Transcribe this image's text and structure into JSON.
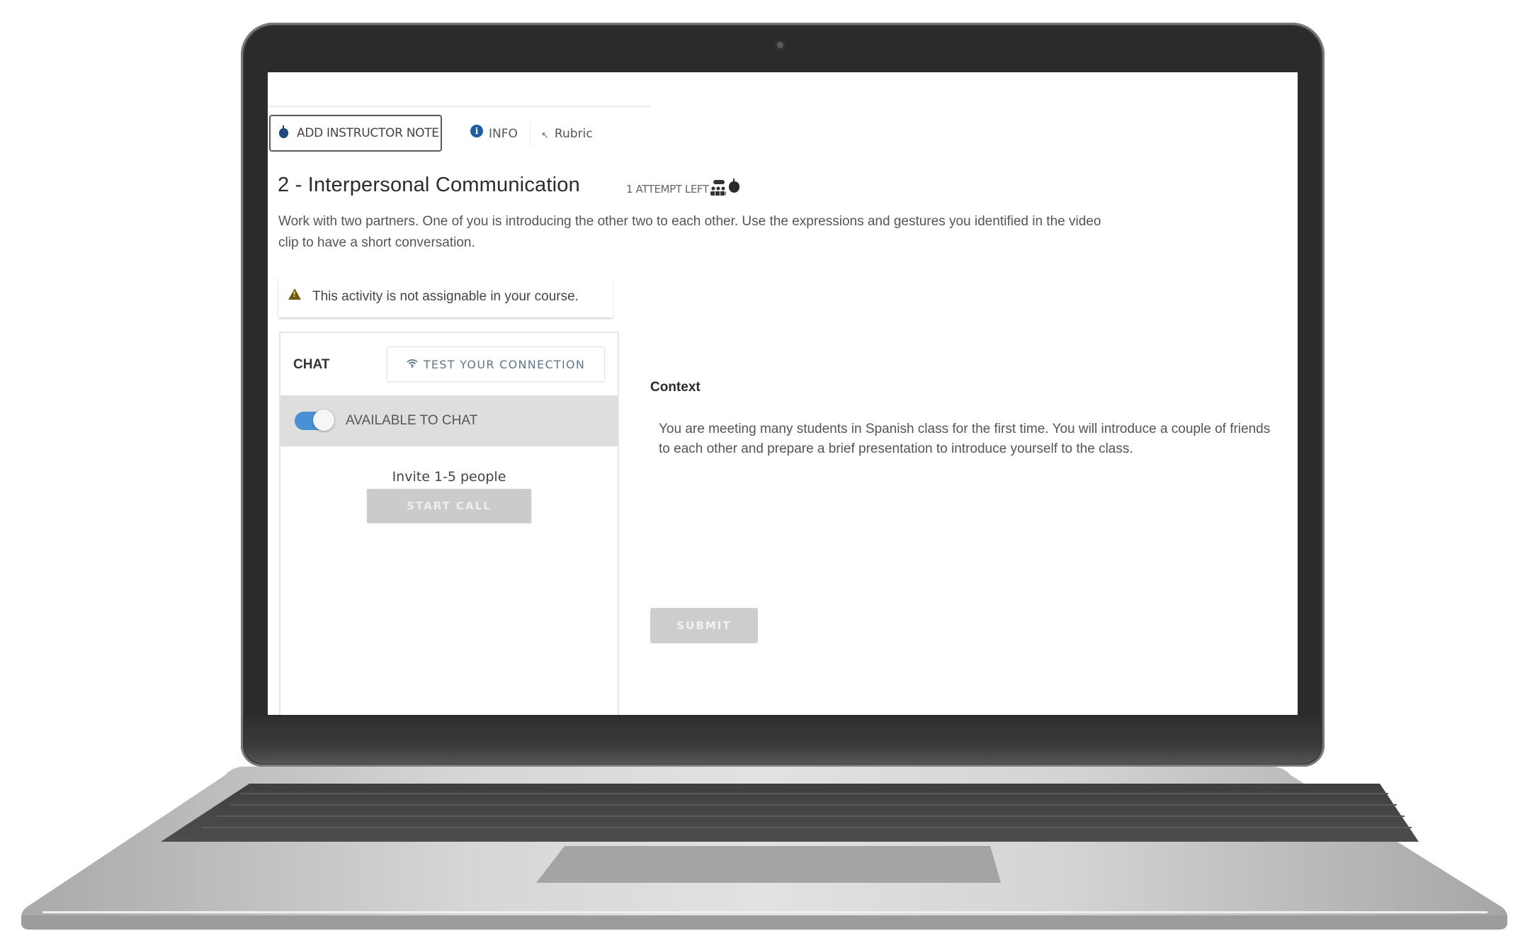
{
  "toolbar": {
    "add_note_label": "ADD INSTRUCTOR NOTE",
    "info_label": "INFO",
    "rubric_label": "Rubric",
    "icons": {
      "add_note": "apple-icon",
      "info": "info-circle-icon",
      "rubric": "arrow-up-left-icon"
    }
  },
  "activity": {
    "title": "2 - Interpersonal Communication",
    "attempts": "1 ATTEMPT LEFT",
    "attempt_icons": [
      "group-presentation-icon",
      "apple-icon"
    ],
    "description": "Work with two partners. One of you is introducing the other two to each other. Use the expressions and gestures you identified in the video clip to have a short conversation."
  },
  "warning": {
    "icon": "warning-triangle-icon",
    "text": "This activity is not assignable in your course."
  },
  "chat": {
    "header": "CHAT",
    "test_connection_label": "TEST YOUR CONNECTION",
    "test_connection_icon": "wifi-icon",
    "availability_label": "AVAILABLE TO CHAT",
    "availability_on": true,
    "invite_text": "Invite 1-5 people",
    "start_call_label": "START CALL"
  },
  "context": {
    "label": "Context",
    "text": "You are meeting many students in Spanish class for the first time. You will introduce a couple of friends to each other and prepare a brief presentation to introduce yourself to the class."
  },
  "actions": {
    "submit_label": "SUBMIT"
  },
  "colors": {
    "accent_blue": "#1f5f9e",
    "toggle_on": "#4a90d4",
    "disabled_button": "#cbcbcb",
    "warning_icon": "#6b5a16",
    "laptop_bezel": "#2b2b2b",
    "laptop_body": "#c8c8c8"
  }
}
